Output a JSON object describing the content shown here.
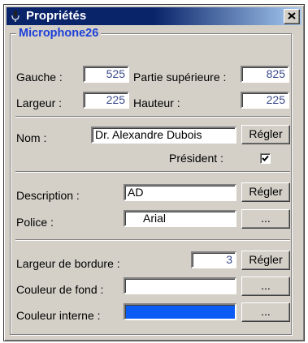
{
  "window": {
    "title": "Propriétés"
  },
  "group": {
    "title": "Microphone26"
  },
  "position": {
    "left_label": "Gauche :",
    "left_value": "525",
    "top_label": "Partie supérieure :",
    "top_value": "825",
    "width_label": "Largeur :",
    "width_value": "225",
    "height_label": "Hauteur :",
    "height_value": "225"
  },
  "name": {
    "label": "Nom :",
    "value": "Dr. Alexandre Dubois",
    "button": "Régler",
    "president_label": "Président :",
    "president_checked": true
  },
  "description": {
    "label": "Description :",
    "value": "AD",
    "button": "Régler"
  },
  "font": {
    "label": "Police :",
    "value": "Arial",
    "button": "..."
  },
  "border": {
    "label": "Largeur de bordure :",
    "value": "3",
    "button": "Régler"
  },
  "background": {
    "label": "Couleur de fond :",
    "color": "#ffffff",
    "button": "..."
  },
  "inner": {
    "label": "Couleur interne :",
    "color": "#0b5cf5",
    "button": "..."
  },
  "icons": {
    "app": "microphone-icon",
    "close": "close-icon",
    "check": "checkmark-icon"
  }
}
